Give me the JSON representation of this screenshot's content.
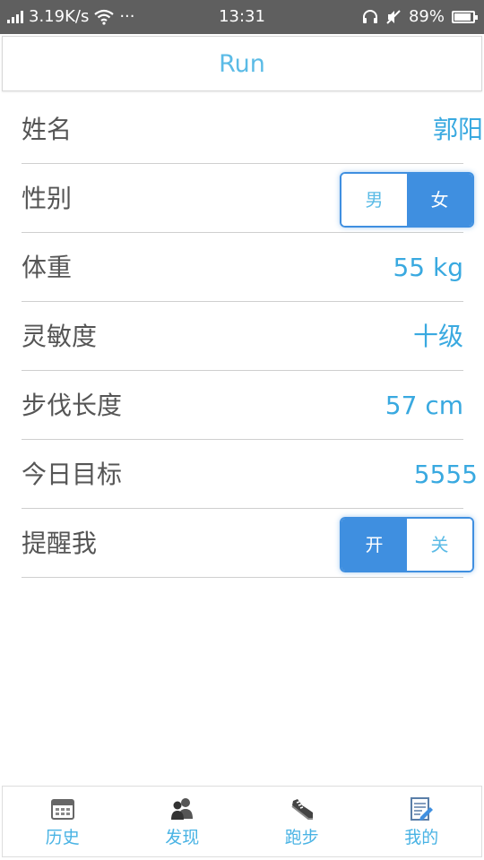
{
  "status_bar": {
    "speed": "3.19K/s",
    "more": "···",
    "time": "13:31",
    "battery_text": "89%",
    "battery_level": 0.89,
    "icons": [
      "signal-icon",
      "wifi-icon",
      "headset-icon",
      "mute-icon",
      "battery-icon"
    ]
  },
  "header": {
    "title": "Run"
  },
  "settings": {
    "name": {
      "label": "姓名",
      "value": "郭阳"
    },
    "gender": {
      "label": "性别",
      "option_male": "男",
      "option_female": "女",
      "selected": "女"
    },
    "weight": {
      "label": "体重",
      "value": "55 kg"
    },
    "sensitivity": {
      "label": "灵敏度",
      "value": "十级"
    },
    "stride": {
      "label": "步伐长度",
      "value": "57 cm"
    },
    "goal": {
      "label": "今日目标",
      "value": "5555"
    },
    "reminder": {
      "label": "提醒我",
      "option_on": "开",
      "option_off": "关",
      "selected": "开"
    }
  },
  "nav": {
    "history": "历史",
    "discover": "发现",
    "run": "跑步",
    "mine": "我的"
  },
  "colors": {
    "accent": "#39a9e0",
    "toggle_active": "#3f8fe0",
    "status_bar_bg": "#5f5f5f"
  }
}
